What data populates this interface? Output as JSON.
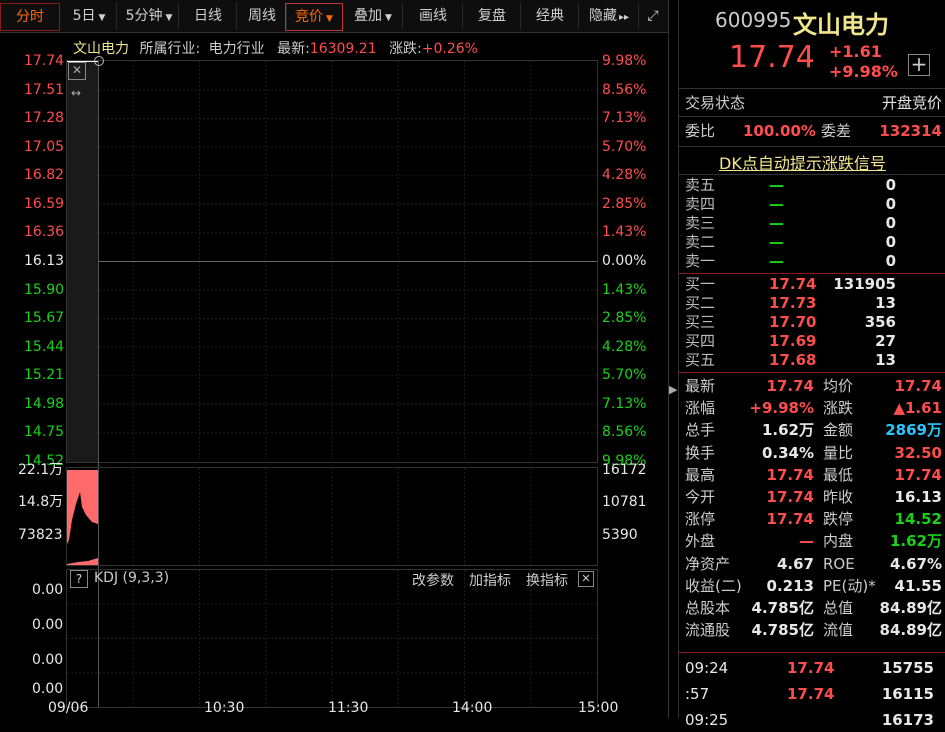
{
  "toolbar": {
    "items": [
      {
        "label": "分时",
        "active": true
      },
      {
        "label": "5日",
        "caret": true
      },
      {
        "label": "5分钟",
        "caret": false
      },
      {
        "label": "日线"
      },
      {
        "label": "周线"
      },
      {
        "label": "竞价",
        "caret": true,
        "highlight": true
      },
      {
        "label": "叠加",
        "caret": true
      },
      {
        "label": "画线"
      },
      {
        "label": "复盘"
      },
      {
        "label": "经典"
      },
      {
        "label": "隐藏"
      }
    ],
    "more_glyph": "▸▸",
    "expand_glyph": "⤢"
  },
  "chart_header": {
    "name": "文山电力",
    "industry_label": "所属行业:",
    "industry": "电力行业",
    "latest_label": "最新:",
    "latest": "16309.21",
    "change_label": "涨跌:",
    "change": "+0.26%"
  },
  "chart_data": [
    {
      "type": "line",
      "title": "",
      "xlabel": "",
      "ylabel": "",
      "x_ticks": [
        "09/06",
        "10:30",
        "11:30",
        "14:00",
        "15:00"
      ],
      "ylim": [
        14.52,
        17.74
      ],
      "y_ticks_left": [
        "17.74",
        "17.51",
        "17.28",
        "17.05",
        "16.82",
        "16.59",
        "16.36",
        "16.13",
        "15.90",
        "15.67",
        "15.44",
        "15.21",
        "14.98",
        "14.75",
        "14.52"
      ],
      "y_ticks_right": [
        "9.98%",
        "8.56%",
        "7.13%",
        "5.70%",
        "4.28%",
        "2.85%",
        "1.43%",
        "0.00%",
        "1.43%",
        "2.85%",
        "4.28%",
        "5.70%",
        "7.13%",
        "8.56%",
        "9.98%"
      ],
      "prev_close": 16.13,
      "series": [
        {
          "values": [
            17.74
          ]
        }
      ]
    },
    {
      "type": "area",
      "title": "",
      "y_ticks_left": [
        "22.1万",
        "14.8万",
        "73823"
      ],
      "y_ticks_right": [
        "16172",
        "10781",
        "5390"
      ]
    },
    {
      "type": "line",
      "title": "KDJ (9,3,3)",
      "y_ticks_left": [
        "0.00",
        "0.00",
        "0.00",
        "0.00"
      ]
    }
  ],
  "kdj_panel": {
    "help": "?",
    "title": "KDJ (9,3,3)",
    "change_params": "改参数",
    "add_indicator": "加指标",
    "switch_indicator": "换指标",
    "close": "✕"
  },
  "stock": {
    "code": "600995",
    "name": "文山电力",
    "price": "17.74",
    "change": "+1.61",
    "change_pct": "+9.98%",
    "add": "+"
  },
  "status": {
    "label": "交易状态",
    "value": "开盘竞价",
    "weibi_label": "委比",
    "weibi": "100.00%",
    "weicha_label": "委差",
    "weicha": "132314"
  },
  "dk_link": "DK点自动提示涨跌信号",
  "sell": [
    {
      "label": "卖五",
      "price": "—",
      "vol": "0"
    },
    {
      "label": "卖四",
      "price": "—",
      "vol": "0"
    },
    {
      "label": "卖三",
      "price": "—",
      "vol": "0"
    },
    {
      "label": "卖二",
      "price": "—",
      "vol": "0"
    },
    {
      "label": "卖一",
      "price": "—",
      "vol": "0"
    }
  ],
  "buy": [
    {
      "label": "买一",
      "price": "17.74",
      "vol": "131905"
    },
    {
      "label": "买二",
      "price": "17.73",
      "vol": "13"
    },
    {
      "label": "买三",
      "price": "17.70",
      "vol": "356"
    },
    {
      "label": "买四",
      "price": "17.69",
      "vol": "27"
    },
    {
      "label": "买五",
      "price": "17.68",
      "vol": "13"
    }
  ],
  "quote": [
    {
      "l1": "最新",
      "v1": "17.74",
      "c1": "red",
      "l2": "均价",
      "v2": "17.74",
      "c2": "red"
    },
    {
      "l1": "涨幅",
      "v1": "+9.98%",
      "c1": "red",
      "l2": "涨跌",
      "v2": "▲1.61",
      "c2": "red"
    },
    {
      "l1": "总手",
      "v1": "1.62万",
      "c1": "white",
      "l2": "金额",
      "v2": "2869万",
      "c2": "cyan"
    },
    {
      "l1": "换手",
      "v1": "0.34%",
      "c1": "white",
      "l2": "量比",
      "v2": "32.50",
      "c2": "red"
    },
    {
      "l1": "最高",
      "v1": "17.74",
      "c1": "red",
      "l2": "最低",
      "v2": "17.74",
      "c2": "red"
    },
    {
      "l1": "今开",
      "v1": "17.74",
      "c1": "red",
      "l2": "昨收",
      "v2": "16.13",
      "c2": "white"
    },
    {
      "l1": "涨停",
      "v1": "17.74",
      "c1": "red",
      "l2": "跌停",
      "v2": "14.52",
      "c2": "green"
    },
    {
      "l1": "外盘",
      "v1": "—",
      "c1": "red",
      "l2": "内盘",
      "v2": "1.62万",
      "c2": "green"
    },
    {
      "l1": "净资产",
      "v1": "4.67",
      "c1": "white",
      "l2": "ROE",
      "v2": "4.67%",
      "c2": "white"
    },
    {
      "l1": "收益(二)",
      "v1": "0.213",
      "c1": "white",
      "l2": "PE(动)*",
      "v2": "41.55",
      "c2": "white"
    },
    {
      "l1": "总股本",
      "v1": "4.785亿",
      "c1": "white",
      "l2": "总值",
      "v2": "84.89亿",
      "c2": "white"
    },
    {
      "l1": "流通股",
      "v1": "4.785亿",
      "c1": "white",
      "l2": "流值",
      "v2": "84.89亿",
      "c2": "white"
    }
  ],
  "ticks": [
    {
      "time": "09:24",
      "price": "17.74",
      "vol": "15755"
    },
    {
      "time": ":57",
      "price": "17.74",
      "vol": "16115"
    },
    {
      "time": "09:25",
      "price": "",
      "vol": "16173"
    }
  ],
  "colors": {
    "up": "#ff4d4d",
    "down": "#19d219",
    "accent": "#ff6a00"
  }
}
